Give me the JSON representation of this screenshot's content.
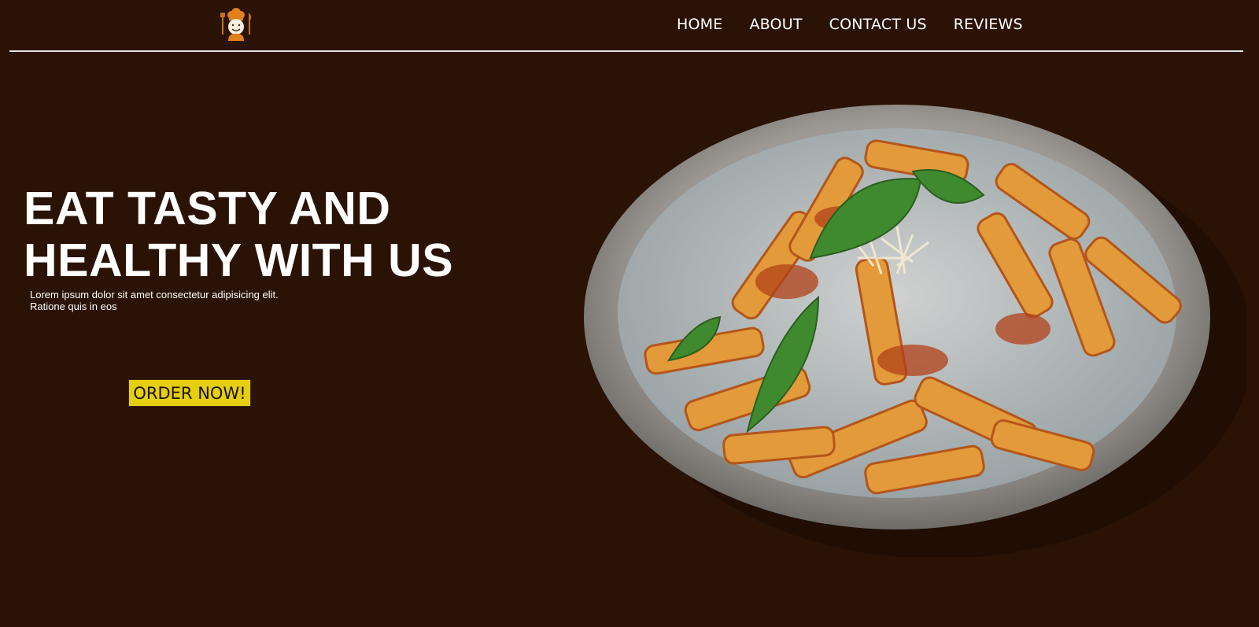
{
  "header": {
    "logo_icon": "chef-mascot-icon",
    "nav": [
      "HOME",
      "ABOUT",
      "CONTACT US",
      "REVIEWS"
    ]
  },
  "hero": {
    "headline": "EAT TASTY AND HEALTHY WITH US",
    "subtext": "Lorem ipsum dolor sit amet consectetur adipisicing elit. Ratione quis in eos",
    "cta_label": "ORDER NOW!",
    "image": "pasta-plate-image"
  },
  "colors": {
    "background": "#2a1205",
    "text": "#ffffff",
    "cta": "#e5cf0e",
    "rule": "#e9e4df"
  }
}
